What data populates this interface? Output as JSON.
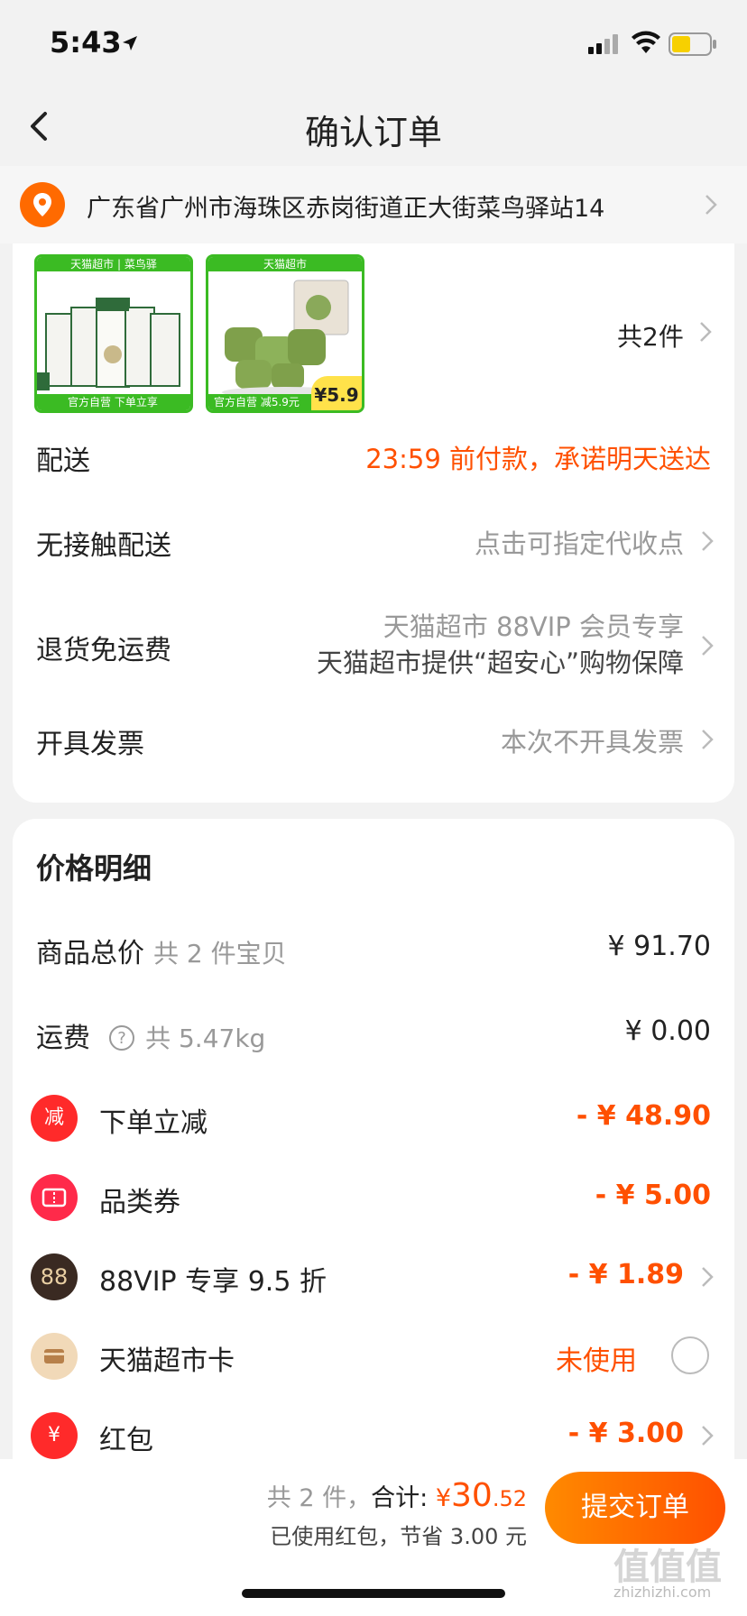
{
  "status_bar": {
    "time": "5:43"
  },
  "nav": {
    "title": "确认订单"
  },
  "address": {
    "text": "广东省广州市海珠区赤岗街道正大街菜鸟驿站14"
  },
  "products": {
    "item1": {
      "top_banner": "天猫超市 | 菜鸟驿",
      "bottom_text": "官方自营  下单立享"
    },
    "item2": {
      "top_banner": "天猫超市",
      "bottom_text": "官方自营  减5.9元",
      "price_tag": "5.9"
    },
    "count": "共2件"
  },
  "delivery": {
    "label": "配送",
    "value": "23:59 前付款，承诺明天送达"
  },
  "contactless": {
    "label": "无接触配送",
    "value": "点击可指定代收点"
  },
  "returns": {
    "label": "退货免运费",
    "value_line1": "天猫超市 88VIP 会员专享",
    "value_line2": "天猫超市提供“超安心”购物保障"
  },
  "invoice": {
    "label": "开具发票",
    "value": "本次不开具发票"
  },
  "price_detail": {
    "title": "价格明细",
    "goods_total": {
      "label": "商品总价",
      "sub": "共 2 件宝贝",
      "value": "¥ 91.70"
    },
    "shipping": {
      "label": "运费",
      "sub": "共 5.47kg",
      "value": "¥ 0.00"
    },
    "instant_discount": {
      "icon_text": "减",
      "label": "下单立减",
      "value": "- ¥ 48.90"
    },
    "category_coupon": {
      "label": "品类券",
      "value": "- ¥ 5.00"
    },
    "vip": {
      "icon_text": "88",
      "label": "88VIP 专享 9.5 折",
      "value": "- ¥ 1.89"
    },
    "tmall_card": {
      "label": "天猫超市卡",
      "value": "未使用"
    },
    "red_packet": {
      "icon_text": "¥",
      "label": "红包",
      "value": "- ¥ 3.00"
    }
  },
  "footer": {
    "count": "共 2 件，",
    "total_label": "合计:",
    "currency": "¥",
    "total_int": "30",
    "total_dec": ".52",
    "saved": "已使用红包，节省 3.00 元",
    "submit": "提交订单"
  },
  "watermark": {
    "text": "值值值",
    "url": "zhizhizhi.com"
  },
  "colors": {
    "accent": "#ff5000",
    "brand_green": "#3bbb23"
  }
}
